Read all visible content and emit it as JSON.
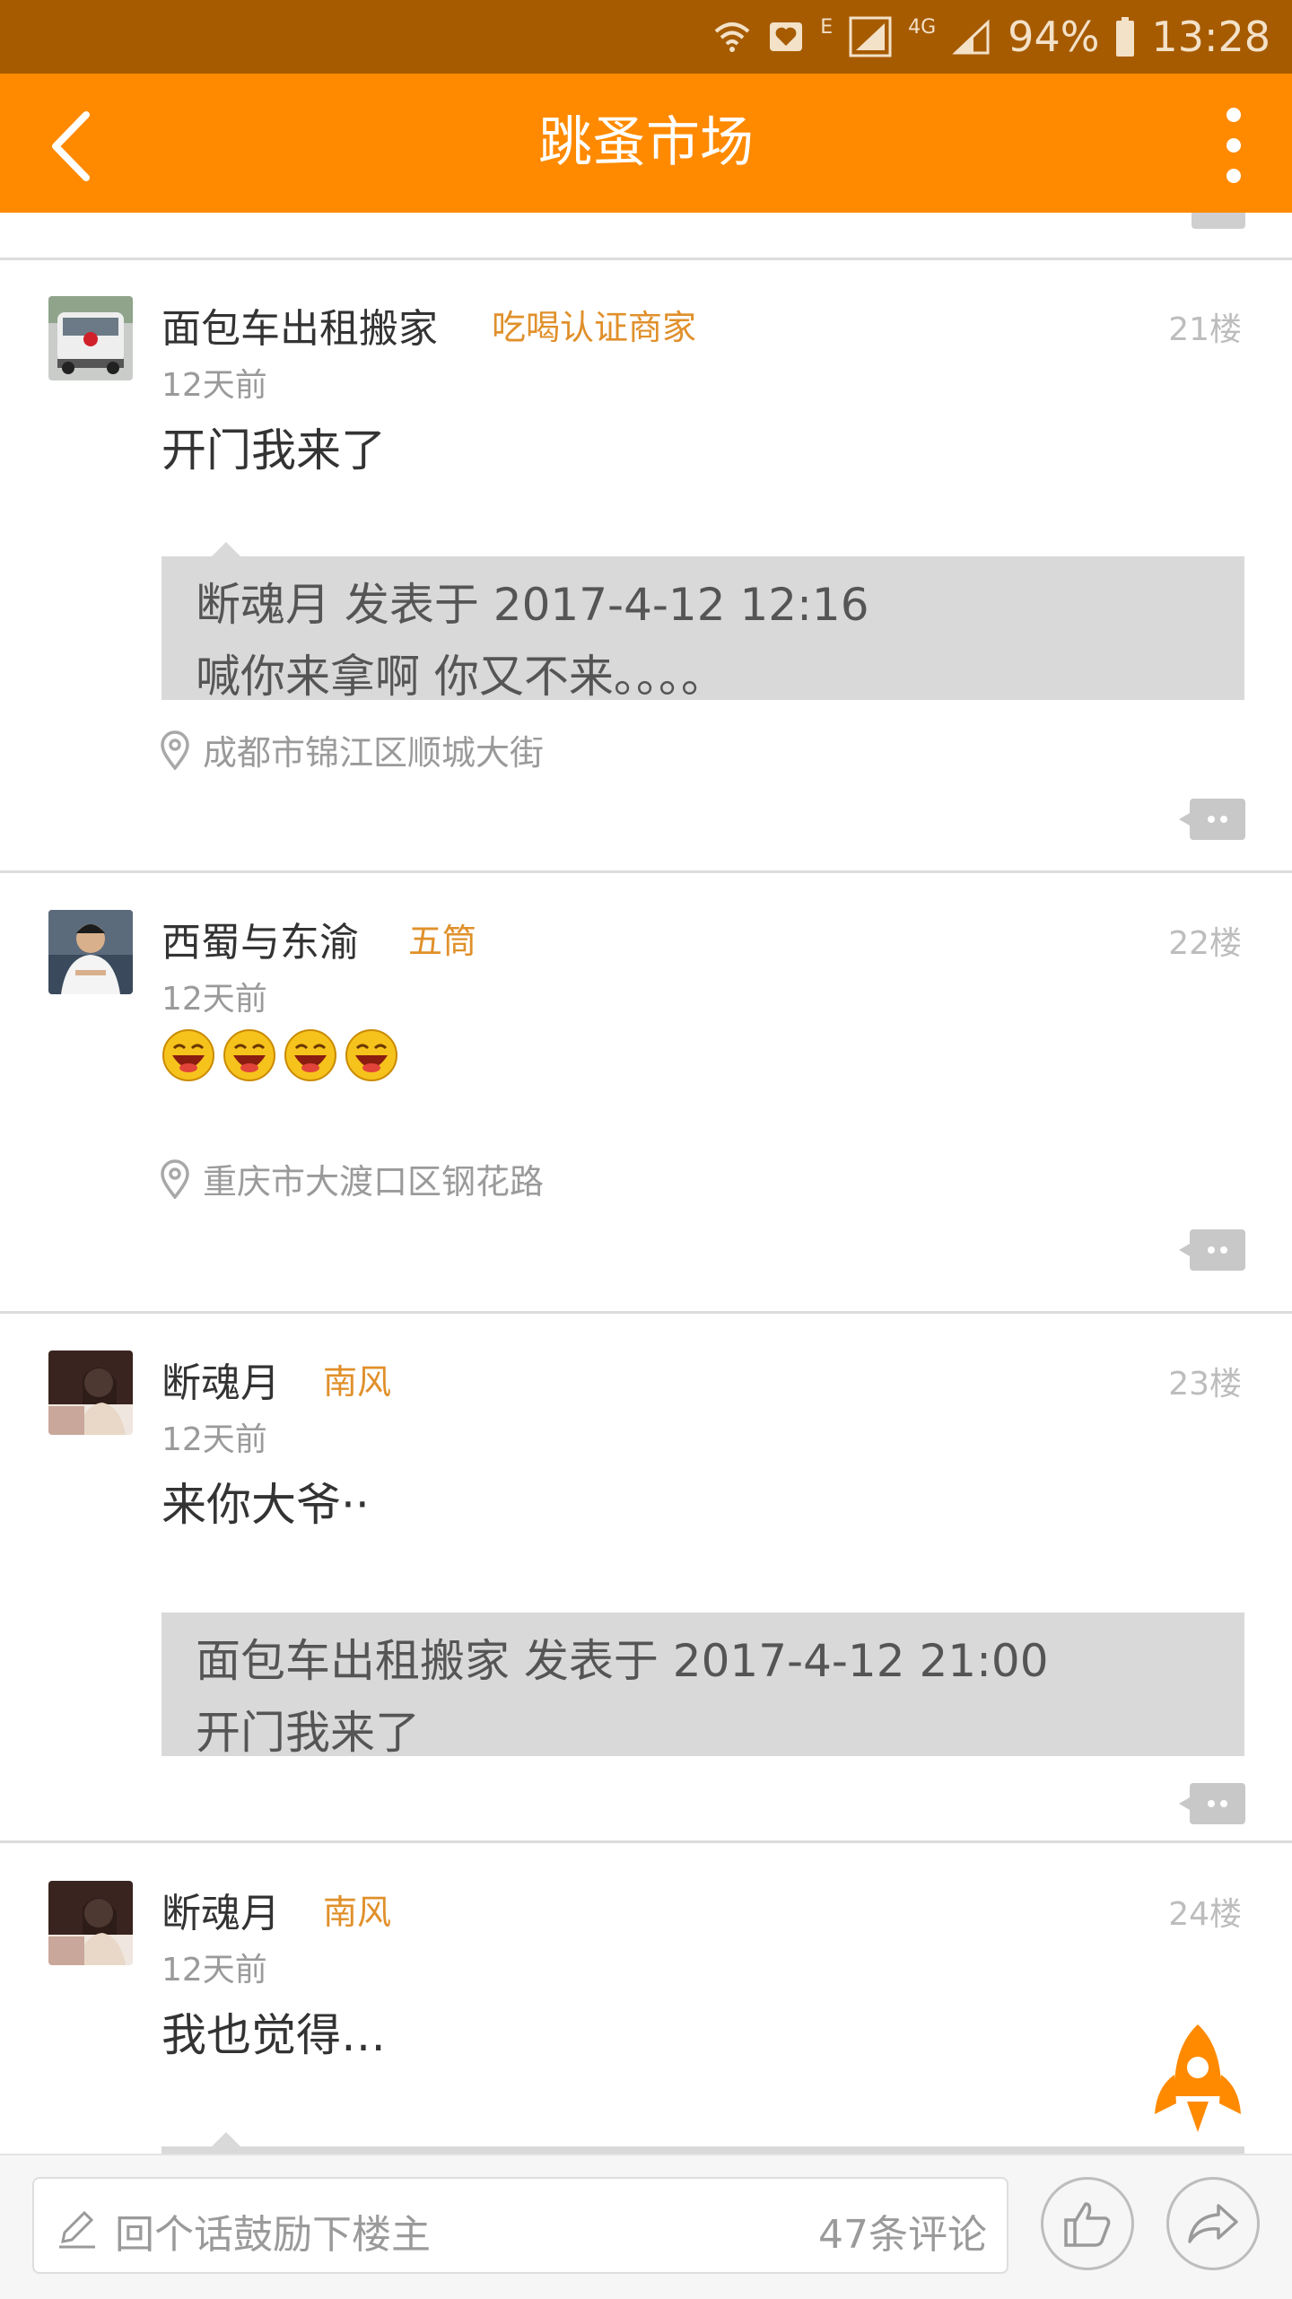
{
  "status_bar": {
    "network_e": "E",
    "network_4g": "4G",
    "battery": "94%",
    "time": "13:28"
  },
  "title_bar": {
    "title": "跳蚤市场"
  },
  "posts": [
    {
      "name": "面包车出租搬家",
      "badge": "吃喝认证商家",
      "time": "12天前",
      "floor": "21楼",
      "content": "开门我来了",
      "quote": {
        "line1": "断魂月 发表于 2017-4-12 12:16",
        "line2": "喊你来拿啊 你又不来。。。。"
      },
      "location": "成都市锦江区顺城大街"
    },
    {
      "name": "西蜀与东渝",
      "badge": "五筒",
      "time": "12天前",
      "floor": "22楼",
      "content_emoji_count": 4,
      "location": "重庆市大渡口区钢花路"
    },
    {
      "name": "断魂月",
      "badge": "南风",
      "time": "12天前",
      "floor": "23楼",
      "content": "来你大爷··",
      "quote": {
        "line1": "面包车出租搬家 发表于 2017-4-12 21:00",
        "line2": "开门我来了"
      }
    },
    {
      "name": "断魂月",
      "badge": "南风",
      "time": "12天前",
      "floor": "24楼",
      "content": "我也觉得…"
    }
  ],
  "bottom_bar": {
    "placeholder": "回个话鼓励下楼主",
    "comment_count": "47条评论"
  },
  "colors": {
    "accent": "#ff8a00",
    "status_bar": "#a65b00",
    "badge": "#e0902b"
  },
  "icons": [
    "wifi-icon",
    "heart-notification-icon",
    "signal-icon",
    "battery-icon",
    "back-icon",
    "more-icon",
    "location-icon",
    "reply-icon",
    "rocket-icon",
    "pen-icon",
    "like-icon",
    "share-icon"
  ]
}
